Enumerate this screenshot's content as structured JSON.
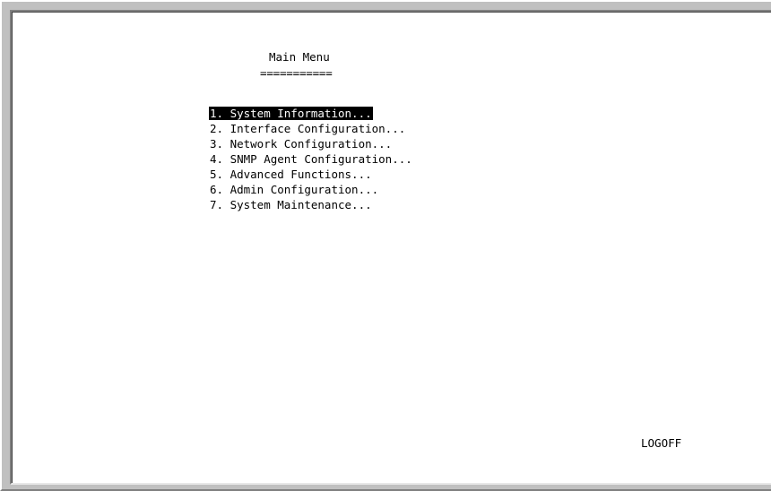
{
  "screen": {
    "title": "Main Menu",
    "title_underline": "==========="
  },
  "menu": {
    "items": [
      {
        "label": "1. System Information...",
        "selected": true
      },
      {
        "label": "2. Interface Configuration...",
        "selected": false
      },
      {
        "label": "3. Network Configuration...",
        "selected": false
      },
      {
        "label": "4. SNMP Agent Configuration...",
        "selected": false
      },
      {
        "label": "5. Advanced Functions...",
        "selected": false
      },
      {
        "label": "6. Admin Configuration...",
        "selected": false
      },
      {
        "label": "7. System Maintenance...",
        "selected": false
      }
    ]
  },
  "footer": {
    "logoff_label": "LOGOFF"
  },
  "colors": {
    "background": "#c0c0c0",
    "terminal_bg": "#ffffff",
    "text": "#000000",
    "highlight_bg": "#000000",
    "highlight_text": "#ffffff"
  }
}
